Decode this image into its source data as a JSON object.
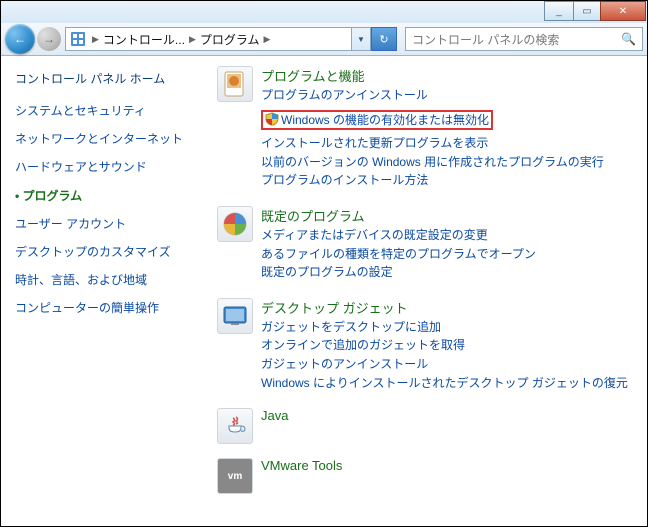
{
  "titlebar": {
    "min": "_",
    "max": "▭",
    "close": "✕"
  },
  "nav": {
    "back": "←",
    "fwd": "→",
    "refresh": "↻"
  },
  "address": {
    "seg1": "コントロール...",
    "seg2": "プログラム",
    "sep": "▶",
    "drop": "▼"
  },
  "search": {
    "placeholder": "コントロール パネルの検索",
    "icon": "🔍"
  },
  "sidebar": {
    "home": "コントロール パネル ホーム",
    "items": [
      "システムとセキュリティ",
      "ネットワークとインターネット",
      "ハードウェアとサウンド",
      "プログラム",
      "ユーザー アカウント",
      "デスクトップのカスタマイズ",
      "時計、言語、および地域",
      "コンピューターの簡単操作"
    ],
    "active_index": 3
  },
  "sections": {
    "programs": {
      "title": "プログラムと機能",
      "links": [
        "プログラムのアンインストール",
        "Windows の機能の有効化または無効化",
        "インストールされた更新プログラムを表示",
        "以前のバージョンの Windows 用に作成されたプログラムの実行",
        "プログラムのインストール方法"
      ],
      "highlighted_index": 1
    },
    "default": {
      "title": "既定のプログラム",
      "links": [
        "メディアまたはデバイスの既定設定の変更",
        "あるファイルの種類を特定のプログラムでオープン",
        "既定のプログラムの設定"
      ]
    },
    "gadgets": {
      "title": "デスクトップ ガジェット",
      "links": [
        "ガジェットをデスクトップに追加",
        "オンラインで追加のガジェットを取得",
        "ガジェットのアンインストール",
        "Windows によりインストールされたデスクトップ ガジェットの復元"
      ]
    },
    "java": {
      "title": "Java"
    },
    "vmware": {
      "title": "VMware Tools"
    }
  }
}
